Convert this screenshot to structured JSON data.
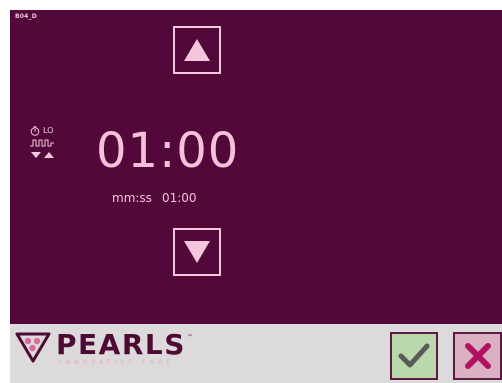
{
  "screen": {
    "id_label": "B04_D"
  },
  "controls": {
    "up_button": "increase-time",
    "down_button": "decrease-time",
    "confirm_button": "confirm",
    "cancel_button": "cancel"
  },
  "mode": {
    "level_label": "LO",
    "icons": [
      "timer-icon",
      "pulse-wave-icon",
      "down-up-arrows-icon"
    ]
  },
  "timer": {
    "value": "01:00",
    "format_label": "mm:ss",
    "secondary_value": "01:00"
  },
  "brand": {
    "name": "PEARLS",
    "trademark": "™",
    "tagline": "INNOVATIVE CARE"
  },
  "colors": {
    "background": "#520939",
    "foreground": "#f6c1d8",
    "bottom_bar": "#dcdadb",
    "confirm": "#b9d8ac",
    "cancel": "#d9b0c4",
    "brand": "#4e0a35"
  }
}
